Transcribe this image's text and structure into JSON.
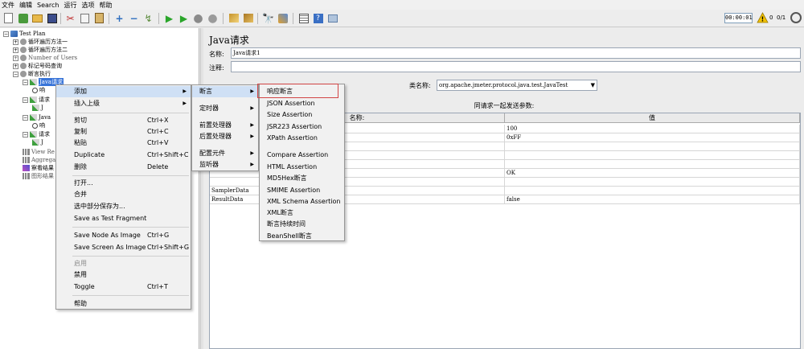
{
  "menubar": [
    "文件",
    "编辑",
    "Search",
    "运行",
    "选项",
    "帮助"
  ],
  "toolbar": {
    "timer": "00:00:01",
    "warning_count": "0",
    "threads": "0/1"
  },
  "tree": {
    "nodes": [
      {
        "label": "Test Plan"
      },
      {
        "label": "循环遍历方法一"
      },
      {
        "label": "循环遍历方法二"
      },
      {
        "label": "Number of Users"
      },
      {
        "label": "标记号码查询"
      },
      {
        "label": "断言执行"
      },
      {
        "label": "Java请求"
      },
      {
        "label": "响"
      },
      {
        "label": "请求"
      },
      {
        "label": "J"
      },
      {
        "label": "Java"
      },
      {
        "label": "响"
      },
      {
        "label": "请求"
      },
      {
        "label": "J"
      },
      {
        "label": "View Re"
      },
      {
        "label": "Aggrega"
      },
      {
        "label": "察看结果"
      },
      {
        "label": "图形结果"
      }
    ]
  },
  "right": {
    "title": "Java请求",
    "name_label": "名称:",
    "name_value": "Java请求1",
    "comment_label": "注释:",
    "classname_label": "类名称:",
    "classname_value": "org.apache.jmeter.protocol.java.test.JavaTest",
    "params_title": "同请求一起发送参数:",
    "col_name": "名称:",
    "col_value": "值",
    "rows": [
      {
        "name": "",
        "value": "100"
      },
      {
        "name": "",
        "value": "0xFF"
      },
      {
        "name": "",
        "value": ""
      },
      {
        "name": "",
        "value": ""
      },
      {
        "name": "",
        "value": ""
      },
      {
        "name": "",
        "value": "OK"
      },
      {
        "name": "",
        "value": ""
      },
      {
        "name": "SamplerData",
        "value": ""
      },
      {
        "name": "ResultData",
        "value": "false"
      }
    ]
  },
  "context_menu": {
    "items": [
      {
        "label": "添加",
        "shortcut": ""
      },
      {
        "label": "插入上级",
        "shortcut": ""
      },
      {
        "label": "剪切",
        "shortcut": "Ctrl+X"
      },
      {
        "label": "复制",
        "shortcut": "Ctrl+C"
      },
      {
        "label": "粘贴",
        "shortcut": "Ctrl+V"
      },
      {
        "label": "Duplicate",
        "shortcut": "Ctrl+Shift+C"
      },
      {
        "label": "删除",
        "shortcut": "Delete"
      },
      {
        "label": "打开...",
        "shortcut": ""
      },
      {
        "label": "合并",
        "shortcut": ""
      },
      {
        "label": "选中部分保存为...",
        "shortcut": ""
      },
      {
        "label": "Save as Test Fragment",
        "shortcut": ""
      },
      {
        "label": "Save Node As Image",
        "shortcut": "Ctrl+G"
      },
      {
        "label": "Save Screen As Image",
        "shortcut": "Ctrl+Shift+G"
      },
      {
        "label": "启用",
        "shortcut": ""
      },
      {
        "label": "禁用",
        "shortcut": ""
      },
      {
        "label": "Toggle",
        "shortcut": "Ctrl+T"
      },
      {
        "label": "帮助",
        "shortcut": ""
      }
    ]
  },
  "add_submenu": {
    "items": [
      {
        "label": "断言"
      },
      {
        "label": "定时器"
      },
      {
        "label": "前置处理器"
      },
      {
        "label": "后置处理器"
      },
      {
        "label": "配置元件"
      },
      {
        "label": "监听器"
      }
    ]
  },
  "assertion_submenu": {
    "items": [
      {
        "label": "响应断言"
      },
      {
        "label": "JSON Assertion"
      },
      {
        "label": "Size Assertion"
      },
      {
        "label": "JSR223 Assertion"
      },
      {
        "label": "XPath Assertion"
      },
      {
        "label": "Compare Assertion"
      },
      {
        "label": "HTML Assertion"
      },
      {
        "label": "MD5Hex断言"
      },
      {
        "label": "SMIME Assertion"
      },
      {
        "label": "XML Schema Assertion"
      },
      {
        "label": "XML断言"
      },
      {
        "label": "断言持续时间"
      },
      {
        "label": "BeanShell断言"
      }
    ]
  },
  "colors": {
    "selection": "#3874d8",
    "highlight_box": "#d24545",
    "menu_hover": "#cfe0f5"
  }
}
